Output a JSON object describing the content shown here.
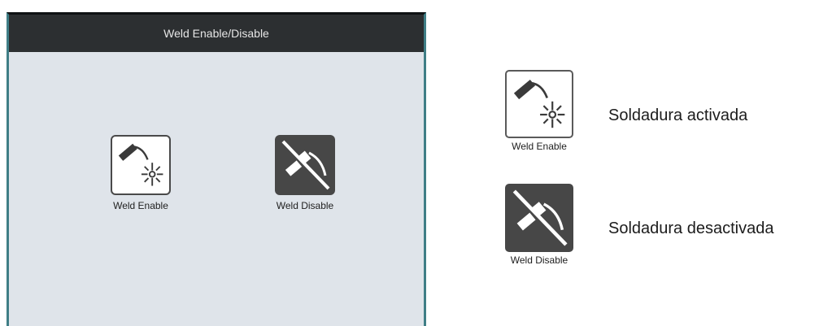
{
  "panel": {
    "title": "Weld Enable/Disable",
    "buttons": [
      {
        "label": "Weld Enable",
        "icon": "weld-enable-icon"
      },
      {
        "label": "Weld Disable",
        "icon": "weld-disable-icon"
      }
    ]
  },
  "legend": [
    {
      "icon_label": "Weld Enable",
      "icon": "weld-enable-icon",
      "description": "Soldadura activada"
    },
    {
      "icon_label": "Weld Disable",
      "icon": "weld-disable-icon",
      "description": "Soldadura desactivada"
    }
  ],
  "colors": {
    "header": "#2c2f31",
    "panel_bg": "#dfe4ea",
    "border_accent": "#3f7e86",
    "icon_dark": "#474747"
  }
}
